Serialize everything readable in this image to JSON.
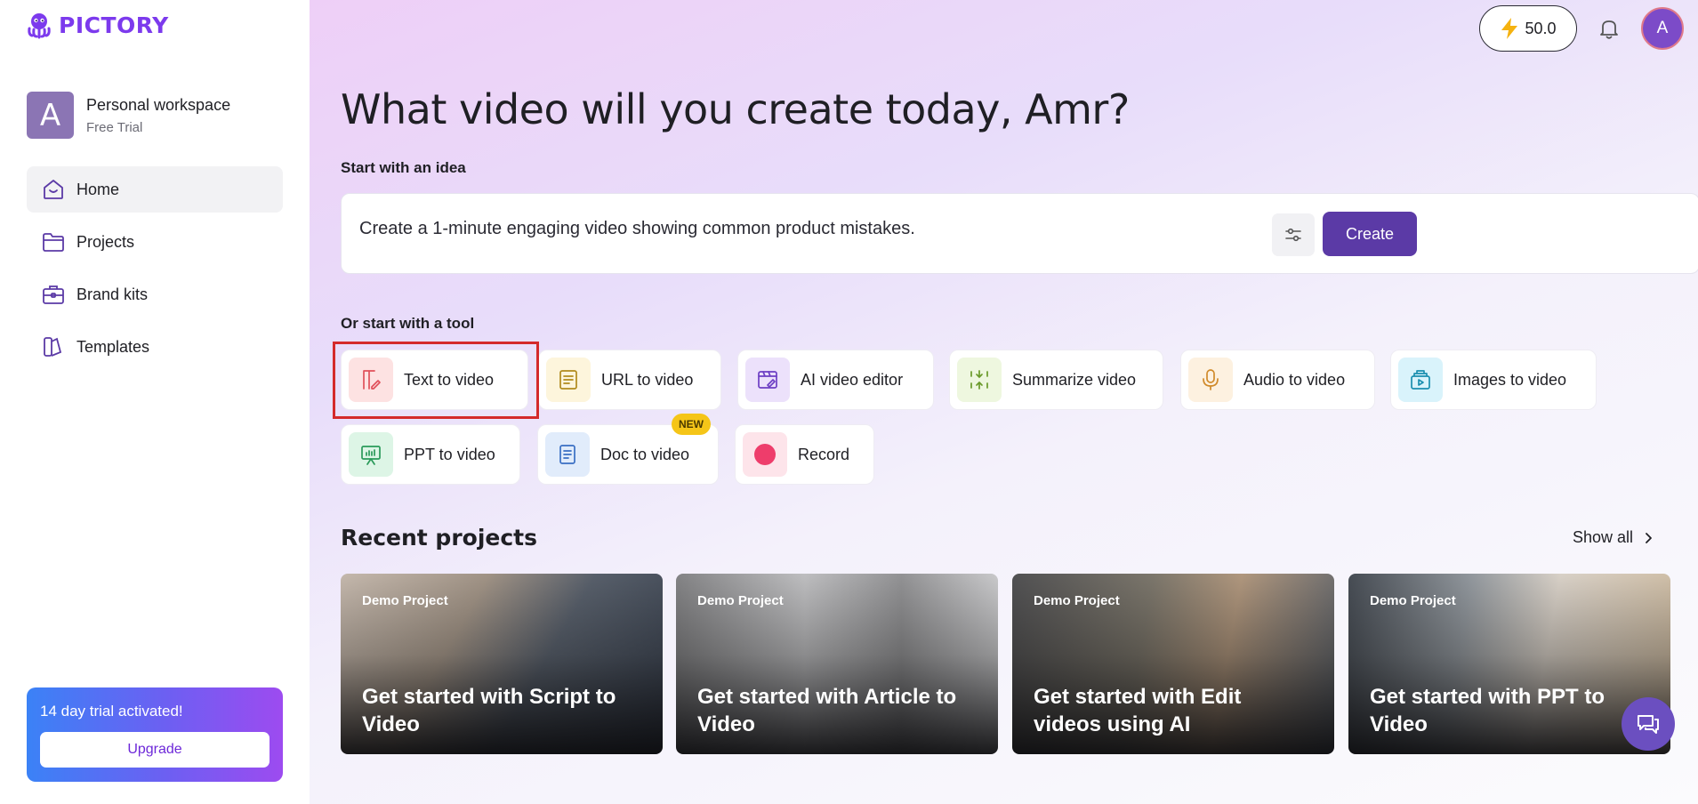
{
  "brand": {
    "name": "PICTORY",
    "accent": "#7c3aed"
  },
  "workspace": {
    "avatar_letter": "A",
    "name": "Personal workspace",
    "plan": "Free Trial"
  },
  "sidebar": {
    "items": [
      {
        "label": "Home",
        "icon": "home-icon",
        "active": true
      },
      {
        "label": "Projects",
        "icon": "folder-icon",
        "active": false
      },
      {
        "label": "Brand kits",
        "icon": "briefcase-icon",
        "active": false
      },
      {
        "label": "Templates",
        "icon": "templates-icon",
        "active": false
      }
    ]
  },
  "trial": {
    "message": "14 day trial activated!",
    "button": "Upgrade"
  },
  "topbar": {
    "credits": "50.0",
    "avatar_letter": "A"
  },
  "main": {
    "title": "What video will you create today, Amr?",
    "idea_label": "Start with an idea",
    "idea_value": "Create a 1-minute engaging video showing common product mistakes.",
    "create_label": "Create",
    "tools_label": "Or start with a tool",
    "tools": [
      {
        "label": "Text to video",
        "icon": "text-to-video-icon",
        "color": "#fde2e2"
      },
      {
        "label": "URL to video",
        "icon": "url-to-video-icon",
        "color": "#fdf5dc"
      },
      {
        "label": "AI video editor",
        "icon": "ai-video-editor-icon",
        "color": "#ece1fb"
      },
      {
        "label": "Summarize video",
        "icon": "summarize-video-icon",
        "color": "#eef7df"
      },
      {
        "label": "Audio to video",
        "icon": "microphone-icon",
        "color": "#fdf1e0"
      },
      {
        "label": "Images to video",
        "icon": "images-to-video-icon",
        "color": "#d9f3fb"
      },
      {
        "label": "PPT to video",
        "icon": "ppt-to-video-icon",
        "color": "#ddf5e6"
      },
      {
        "label": "Doc to video",
        "icon": "doc-to-video-icon",
        "color": "#e1ecfb"
      },
      {
        "label": "Record",
        "icon": "record-icon",
        "color": "#fde4ea"
      }
    ],
    "new_badge": "NEW",
    "recent_title": "Recent projects",
    "show_all": "Show all",
    "projects": [
      {
        "tag": "Demo Project",
        "title": "Get started with Script to Video"
      },
      {
        "tag": "Demo Project",
        "title": "Get started with Article to Video"
      },
      {
        "tag": "Demo Project",
        "title": "Get started with Edit videos using AI"
      },
      {
        "tag": "Demo Project",
        "title": "Get started with PPT to Video"
      }
    ]
  }
}
